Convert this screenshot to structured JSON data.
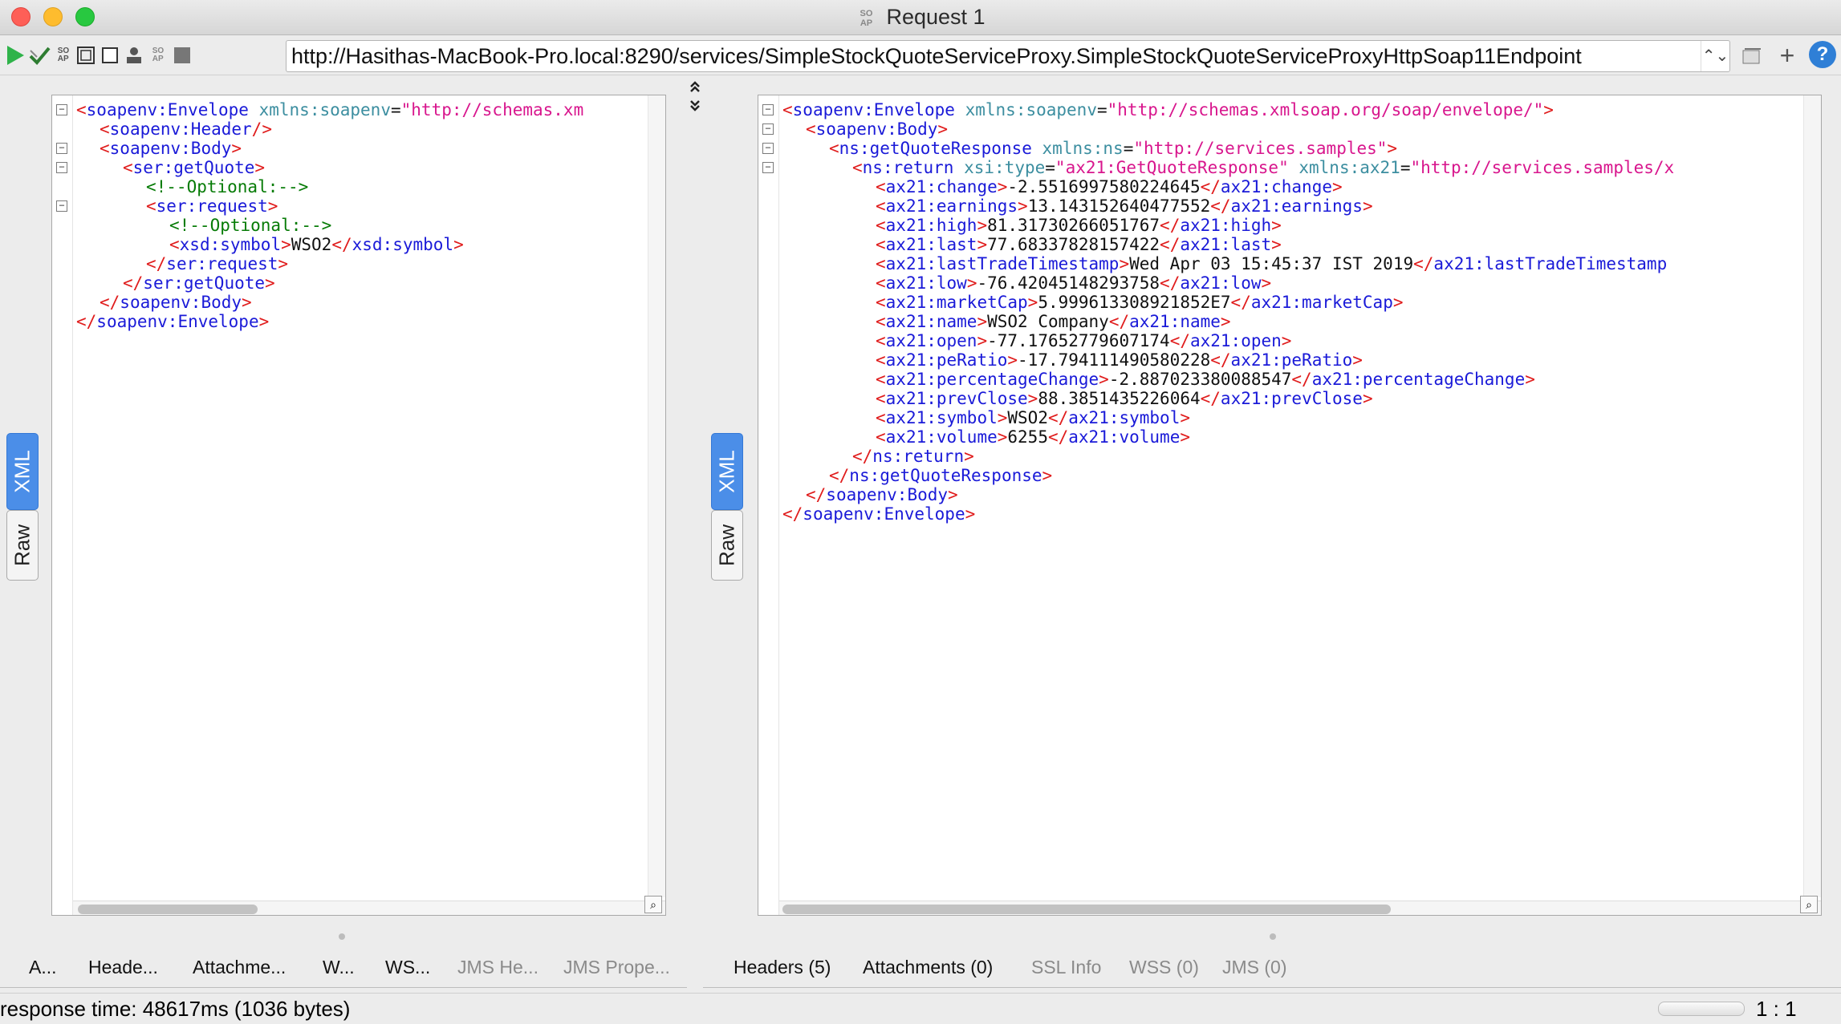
{
  "window": {
    "title": "Request 1",
    "logo_text": "SO AP"
  },
  "toolbar": {
    "url": "http://Hasithas-MacBook-Pro.local:8290/services/SimpleStockQuoteServiceProxy.SimpleStockQuoteServiceProxyHttpSoap11Endpoint",
    "icons": [
      "play-icon",
      "validate-icon",
      "soap-icon",
      "layout-icon",
      "stop-square-icon",
      "user-icon",
      "soap-small-icon",
      "stop-icon"
    ],
    "stepper": "⌃⌄",
    "help_label": "?"
  },
  "request_pane": {
    "tabs": {
      "xml": "XML",
      "raw": "Raw"
    },
    "lines": [
      {
        "indent": 0,
        "parts": [
          [
            "tag",
            "<"
          ],
          [
            "tn",
            "soapenv:Envelope"
          ],
          [
            "tx",
            " "
          ],
          [
            "an",
            "xmlns:soapenv"
          ],
          [
            "tx",
            "="
          ],
          [
            "av",
            "\"http://schemas.xm"
          ]
        ]
      },
      {
        "indent": 1,
        "parts": [
          [
            "tag",
            "<"
          ],
          [
            "tn",
            "soapenv:Header"
          ],
          [
            "tag",
            "/>"
          ]
        ]
      },
      {
        "indent": 1,
        "parts": [
          [
            "tag",
            "<"
          ],
          [
            "tn",
            "soapenv:Body"
          ],
          [
            "tag",
            ">"
          ]
        ]
      },
      {
        "indent": 2,
        "parts": [
          [
            "tag",
            "<"
          ],
          [
            "tn",
            "ser:getQuote"
          ],
          [
            "tag",
            ">"
          ]
        ]
      },
      {
        "indent": 3,
        "parts": [
          [
            "cm",
            "<!--Optional:-->"
          ]
        ]
      },
      {
        "indent": 3,
        "parts": [
          [
            "tag",
            "<"
          ],
          [
            "tn",
            "ser:request"
          ],
          [
            "tag",
            ">"
          ]
        ]
      },
      {
        "indent": 4,
        "parts": [
          [
            "cm",
            "<!--Optional:-->"
          ]
        ]
      },
      {
        "indent": 4,
        "parts": [
          [
            "tag",
            "<"
          ],
          [
            "tn",
            "xsd:symbol"
          ],
          [
            "tag",
            ">"
          ],
          [
            "tx",
            "WSO2"
          ],
          [
            "tag",
            "</"
          ],
          [
            "tn",
            "xsd:symbol"
          ],
          [
            "tag",
            ">"
          ]
        ]
      },
      {
        "indent": 3,
        "parts": [
          [
            "tag",
            "</"
          ],
          [
            "tn",
            "ser:request"
          ],
          [
            "tag",
            ">"
          ]
        ]
      },
      {
        "indent": 2,
        "parts": [
          [
            "tag",
            "</"
          ],
          [
            "tn",
            "ser:getQuote"
          ],
          [
            "tag",
            ">"
          ]
        ]
      },
      {
        "indent": 1,
        "parts": [
          [
            "tag",
            "</"
          ],
          [
            "tn",
            "soapenv:Body"
          ],
          [
            "tag",
            ">"
          ]
        ]
      },
      {
        "indent": 0,
        "parts": [
          [
            "tag",
            "</"
          ],
          [
            "tn",
            "soapenv:Envelope"
          ],
          [
            "tag",
            ">"
          ]
        ]
      }
    ],
    "bottom_tabs": [
      "A...",
      "Heade...",
      "Attachme...",
      "W...",
      "WS...",
      "JMS He...",
      "JMS Prope..."
    ]
  },
  "response_pane": {
    "tabs": {
      "xml": "XML",
      "raw": "Raw"
    },
    "lines": [
      {
        "indent": 0,
        "parts": [
          [
            "tag",
            "<"
          ],
          [
            "tn",
            "soapenv:Envelope"
          ],
          [
            "tx",
            " "
          ],
          [
            "an",
            "xmlns:soapenv"
          ],
          [
            "tx",
            "="
          ],
          [
            "av",
            "\"http://schemas.xmlsoap.org/soap/envelope/\""
          ],
          [
            "tag",
            ">"
          ]
        ]
      },
      {
        "indent": 1,
        "parts": [
          [
            "tag",
            "<"
          ],
          [
            "tn",
            "soapenv:Body"
          ],
          [
            "tag",
            ">"
          ]
        ]
      },
      {
        "indent": 2,
        "parts": [
          [
            "tag",
            "<"
          ],
          [
            "tn",
            "ns:getQuoteResponse"
          ],
          [
            "tx",
            " "
          ],
          [
            "an",
            "xmlns:ns"
          ],
          [
            "tx",
            "="
          ],
          [
            "av",
            "\"http://services.samples\""
          ],
          [
            "tag",
            ">"
          ]
        ]
      },
      {
        "indent": 3,
        "parts": [
          [
            "tag",
            "<"
          ],
          [
            "tn",
            "ns:return"
          ],
          [
            "tx",
            " "
          ],
          [
            "an",
            "xsi:type"
          ],
          [
            "tx",
            "="
          ],
          [
            "av",
            "\"ax21:GetQuoteResponse\""
          ],
          [
            "tx",
            " "
          ],
          [
            "an",
            "xmlns:ax21"
          ],
          [
            "tx",
            "="
          ],
          [
            "av",
            "\"http://services.samples/x"
          ]
        ]
      },
      {
        "indent": 4,
        "parts": [
          [
            "tag",
            "<"
          ],
          [
            "tn",
            "ax21:change"
          ],
          [
            "tag",
            ">"
          ],
          [
            "tx",
            "-2.5516997580224645"
          ],
          [
            "tag",
            "</"
          ],
          [
            "tn",
            "ax21:change"
          ],
          [
            "tag",
            ">"
          ]
        ]
      },
      {
        "indent": 4,
        "parts": [
          [
            "tag",
            "<"
          ],
          [
            "tn",
            "ax21:earnings"
          ],
          [
            "tag",
            ">"
          ],
          [
            "tx",
            "13.143152640477552"
          ],
          [
            "tag",
            "</"
          ],
          [
            "tn",
            "ax21:earnings"
          ],
          [
            "tag",
            ">"
          ]
        ]
      },
      {
        "indent": 4,
        "parts": [
          [
            "tag",
            "<"
          ],
          [
            "tn",
            "ax21:high"
          ],
          [
            "tag",
            ">"
          ],
          [
            "tx",
            "81.31730266051767"
          ],
          [
            "tag",
            "</"
          ],
          [
            "tn",
            "ax21:high"
          ],
          [
            "tag",
            ">"
          ]
        ]
      },
      {
        "indent": 4,
        "parts": [
          [
            "tag",
            "<"
          ],
          [
            "tn",
            "ax21:last"
          ],
          [
            "tag",
            ">"
          ],
          [
            "tx",
            "77.68337828157422"
          ],
          [
            "tag",
            "</"
          ],
          [
            "tn",
            "ax21:last"
          ],
          [
            "tag",
            ">"
          ]
        ]
      },
      {
        "indent": 4,
        "parts": [
          [
            "tag",
            "<"
          ],
          [
            "tn",
            "ax21:lastTradeTimestamp"
          ],
          [
            "tag",
            ">"
          ],
          [
            "tx",
            "Wed Apr 03 15:45:37 IST 2019"
          ],
          [
            "tag",
            "</"
          ],
          [
            "tn",
            "ax21:lastTradeTimestamp"
          ]
        ]
      },
      {
        "indent": 4,
        "parts": [
          [
            "tag",
            "<"
          ],
          [
            "tn",
            "ax21:low"
          ],
          [
            "tag",
            ">"
          ],
          [
            "tx",
            "-76.42045148293758"
          ],
          [
            "tag",
            "</"
          ],
          [
            "tn",
            "ax21:low"
          ],
          [
            "tag",
            ">"
          ]
        ]
      },
      {
        "indent": 4,
        "parts": [
          [
            "tag",
            "<"
          ],
          [
            "tn",
            "ax21:marketCap"
          ],
          [
            "tag",
            ">"
          ],
          [
            "tx",
            "5.999613308921852E7"
          ],
          [
            "tag",
            "</"
          ],
          [
            "tn",
            "ax21:marketCap"
          ],
          [
            "tag",
            ">"
          ]
        ]
      },
      {
        "indent": 4,
        "parts": [
          [
            "tag",
            "<"
          ],
          [
            "tn",
            "ax21:name"
          ],
          [
            "tag",
            ">"
          ],
          [
            "tx",
            "WSO2 Company"
          ],
          [
            "tag",
            "</"
          ],
          [
            "tn",
            "ax21:name"
          ],
          [
            "tag",
            ">"
          ]
        ]
      },
      {
        "indent": 4,
        "parts": [
          [
            "tag",
            "<"
          ],
          [
            "tn",
            "ax21:open"
          ],
          [
            "tag",
            ">"
          ],
          [
            "tx",
            "-77.17652779607174"
          ],
          [
            "tag",
            "</"
          ],
          [
            "tn",
            "ax21:open"
          ],
          [
            "tag",
            ">"
          ]
        ]
      },
      {
        "indent": 4,
        "parts": [
          [
            "tag",
            "<"
          ],
          [
            "tn",
            "ax21:peRatio"
          ],
          [
            "tag",
            ">"
          ],
          [
            "tx",
            "-17.794111490580228"
          ],
          [
            "tag",
            "</"
          ],
          [
            "tn",
            "ax21:peRatio"
          ],
          [
            "tag",
            ">"
          ]
        ]
      },
      {
        "indent": 4,
        "parts": [
          [
            "tag",
            "<"
          ],
          [
            "tn",
            "ax21:percentageChange"
          ],
          [
            "tag",
            ">"
          ],
          [
            "tx",
            "-2.887023380088547"
          ],
          [
            "tag",
            "</"
          ],
          [
            "tn",
            "ax21:percentageChange"
          ],
          [
            "tag",
            ">"
          ]
        ]
      },
      {
        "indent": 4,
        "parts": [
          [
            "tag",
            "<"
          ],
          [
            "tn",
            "ax21:prevClose"
          ],
          [
            "tag",
            ">"
          ],
          [
            "tx",
            "88.3851435226064"
          ],
          [
            "tag",
            "</"
          ],
          [
            "tn",
            "ax21:prevClose"
          ],
          [
            "tag",
            ">"
          ]
        ]
      },
      {
        "indent": 4,
        "parts": [
          [
            "tag",
            "<"
          ],
          [
            "tn",
            "ax21:symbol"
          ],
          [
            "tag",
            ">"
          ],
          [
            "tx",
            "WSO2"
          ],
          [
            "tag",
            "</"
          ],
          [
            "tn",
            "ax21:symbol"
          ],
          [
            "tag",
            ">"
          ]
        ]
      },
      {
        "indent": 4,
        "parts": [
          [
            "tag",
            "<"
          ],
          [
            "tn",
            "ax21:volume"
          ],
          [
            "tag",
            ">"
          ],
          [
            "tx",
            "6255"
          ],
          [
            "tag",
            "</"
          ],
          [
            "tn",
            "ax21:volume"
          ],
          [
            "tag",
            ">"
          ]
        ]
      },
      {
        "indent": 3,
        "parts": [
          [
            "tag",
            "</"
          ],
          [
            "tn",
            "ns:return"
          ],
          [
            "tag",
            ">"
          ]
        ]
      },
      {
        "indent": 2,
        "parts": [
          [
            "tag",
            "</"
          ],
          [
            "tn",
            "ns:getQuoteResponse"
          ],
          [
            "tag",
            ">"
          ]
        ]
      },
      {
        "indent": 1,
        "parts": [
          [
            "tag",
            "</"
          ],
          [
            "tn",
            "soapenv:Body"
          ],
          [
            "tag",
            ">"
          ]
        ]
      },
      {
        "indent": 0,
        "parts": [
          [
            "tag",
            "</"
          ],
          [
            "tn",
            "soapenv:Envelope"
          ],
          [
            "tag",
            ">"
          ]
        ]
      }
    ],
    "bottom_tabs": [
      {
        "label": "Headers (5)",
        "dim": false
      },
      {
        "label": "Attachments (0)",
        "dim": false
      },
      {
        "label": "SSL Info",
        "dim": true
      },
      {
        "label": "WSS (0)",
        "dim": true
      },
      {
        "label": "JMS (0)",
        "dim": true
      }
    ]
  },
  "status": {
    "response_time": "response time: 48617ms (1036 bytes)",
    "ratio": "1 : 1"
  }
}
